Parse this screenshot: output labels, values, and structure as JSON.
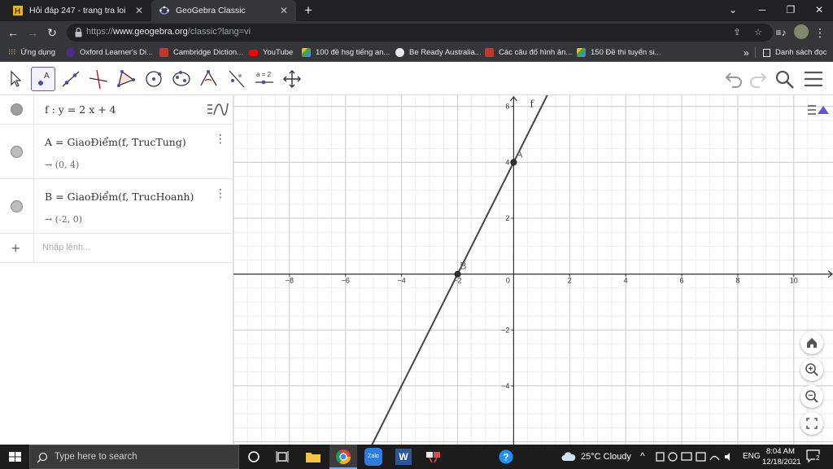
{
  "browser": {
    "tabs": [
      {
        "title": "Hỏi đáp 247 - trang tra loi",
        "active": false
      },
      {
        "title": "GeoGebra Classic",
        "active": true
      }
    ],
    "new_tab": "+",
    "url_scheme": "https://",
    "url_host": "www.geogebra.org",
    "url_path": "/classic?lang=vi",
    "bookmarks": [
      "Ứng dụng",
      "Oxford Learner's Di...",
      "Cambridge Diction...",
      "YouTube",
      "100 đề hsg tiếng an...",
      "Be Ready Australia...",
      "Các câu đố hình ản...",
      "150 Đề thi tuyển si..."
    ],
    "bookmarks_overflow": "»",
    "reading_list": "Danh sách đọc"
  },
  "algebra": {
    "items": [
      {
        "definition": "f : y = 2 x + 4",
        "value": ""
      },
      {
        "definition": "A = GiaoĐiểm(f, TrucTung)",
        "value": "→ (0, 4)"
      },
      {
        "definition": "B = GiaoĐiểm(f, TrucHoanh)",
        "value": "→ (-2, 0)"
      }
    ],
    "input_placeholder": "Nhập lệnh..."
  },
  "graph": {
    "x_ticks": [
      -8,
      -6,
      -4,
      -2,
      0,
      2,
      4,
      6,
      8,
      10
    ],
    "y_ticks": [
      -4,
      -2,
      2,
      4,
      6
    ],
    "x_range": [
      -10,
      11.4
    ],
    "y_range": [
      -6.1,
      6.4
    ],
    "line": {
      "name": "f",
      "slope": 2,
      "intercept": 4
    },
    "points": [
      {
        "name": "A",
        "x": 0,
        "y": 4
      },
      {
        "name": "B",
        "x": -2,
        "y": 0
      }
    ],
    "line_color": "#444444",
    "point_color": "#333333"
  },
  "taskbar": {
    "search_placeholder": "Type here to search",
    "weather": "25°C  Cloudy",
    "language": "ENG",
    "time": "8:04 AM",
    "date": "12/18/2021",
    "notifications": "2"
  }
}
